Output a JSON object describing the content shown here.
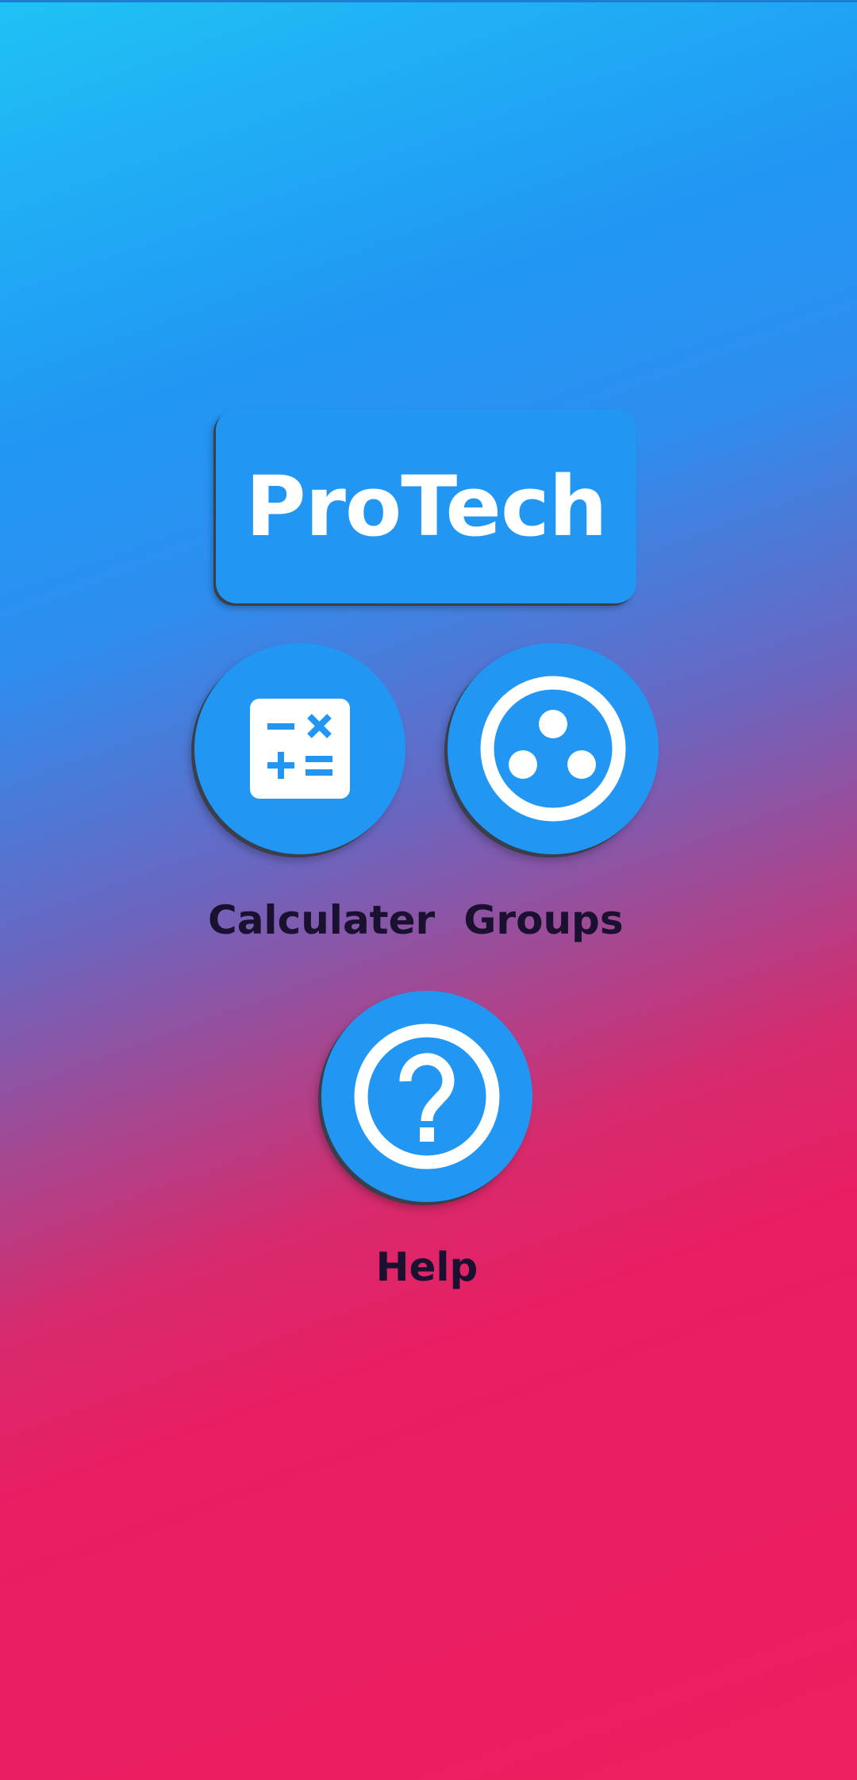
{
  "app": {
    "title": "ProTech"
  },
  "menu": {
    "items": [
      {
        "label": "Calculater",
        "icon": "calculator-icon"
      },
      {
        "label": "Groups",
        "icon": "group-work-icon"
      },
      {
        "label": "Help",
        "icon": "help-circle-icon"
      }
    ]
  },
  "colors": {
    "accent": "#2196f3",
    "gradient_top": "#1fc2f5",
    "gradient_bottom": "#e91e63",
    "label_text": "#1a1030"
  }
}
